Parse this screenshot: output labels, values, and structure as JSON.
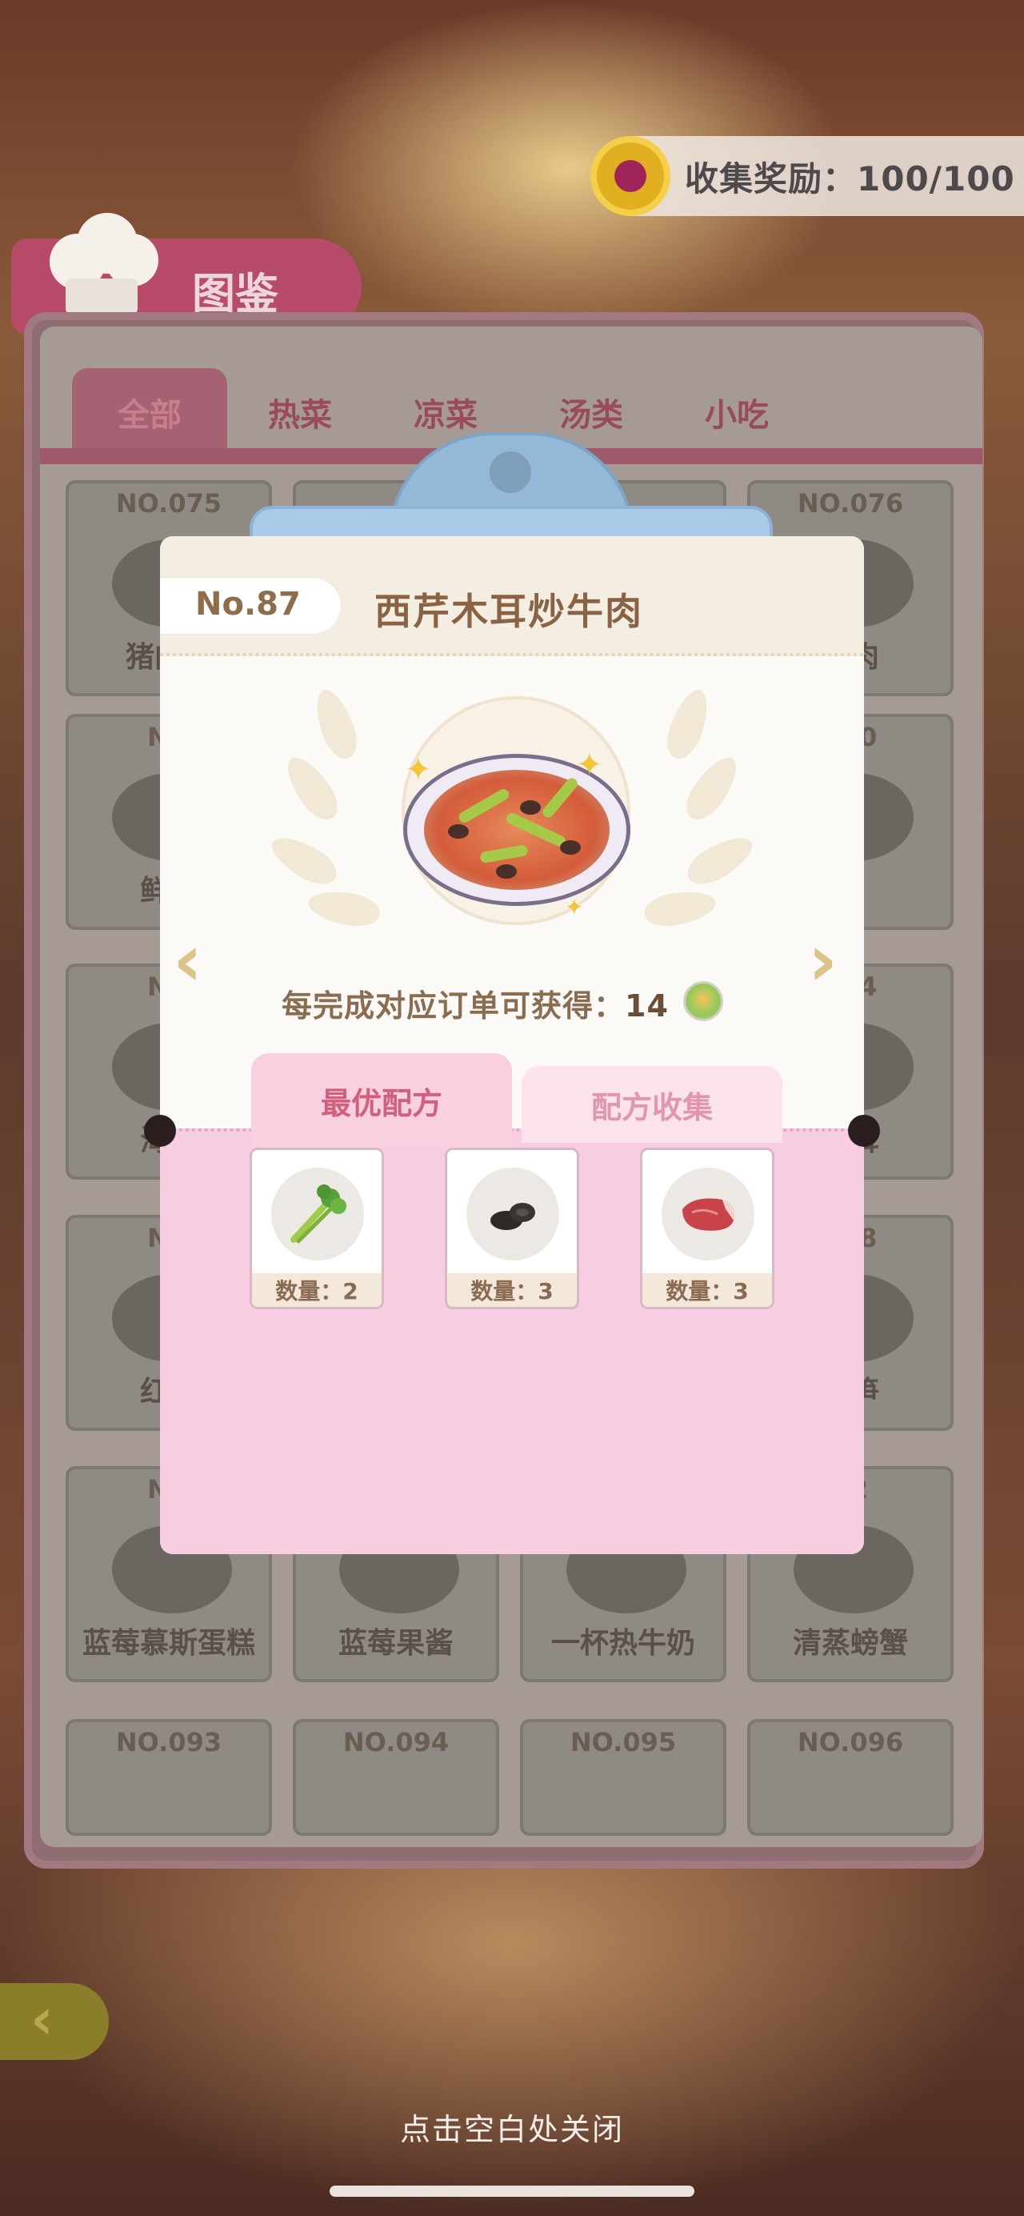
{
  "collection_reward": {
    "label": "收集奖励：100/100"
  },
  "page_title": "图鉴",
  "category_tabs": [
    {
      "label": "全部",
      "active": true
    },
    {
      "label": "热菜",
      "active": false
    },
    {
      "label": "凉菜",
      "active": false
    },
    {
      "label": "汤类",
      "active": false
    },
    {
      "label": "小吃",
      "active": false
    }
  ],
  "grid_cells": [
    {
      "no": "NO.075",
      "name": "猪肉酿"
    },
    {
      "no": "",
      "name": ""
    },
    {
      "no": "",
      "name": ""
    },
    {
      "no": "NO.076",
      "name": "塞肉"
    },
    {
      "no": "NO",
      "name": "鲜虾"
    },
    {
      "no": "",
      "name": ""
    },
    {
      "no": "",
      "name": ""
    },
    {
      "no": "080",
      "name": "子"
    },
    {
      "no": "NO",
      "name": "海鲜"
    },
    {
      "no": "",
      "name": ""
    },
    {
      "no": "",
      "name": ""
    },
    {
      "no": "084",
      "name": "木耳"
    },
    {
      "no": "NO",
      "name": "红烧"
    },
    {
      "no": "",
      "name": ""
    },
    {
      "no": "",
      "name": ""
    },
    {
      "no": "088",
      "name": "莴笋"
    },
    {
      "no": "NO",
      "name": "蓝莓慕斯蛋糕"
    },
    {
      "no": "",
      "name": "蓝莓果酱"
    },
    {
      "no": "",
      "name": "一杯热牛奶"
    },
    {
      "no": "92",
      "name": "清蒸螃蟹"
    },
    {
      "no": "NO.093",
      "name": ""
    },
    {
      "no": "NO.094",
      "name": ""
    },
    {
      "no": "NO.095",
      "name": ""
    },
    {
      "no": "NO.096",
      "name": ""
    }
  ],
  "dialog": {
    "number": "No.87",
    "dish_name": "西芹木耳炒牛肉",
    "reward_prefix": "每完成对应订单可获得：",
    "reward_amount": "14",
    "recipe_tabs": {
      "best": "最优配方",
      "collect": "配方收集"
    },
    "ingredients": [
      {
        "icon": "celery-icon",
        "qty": "数量：2"
      },
      {
        "icon": "wood-ear-mushroom-icon",
        "qty": "数量：3"
      },
      {
        "icon": "beef-icon",
        "qty": "数量：3"
      }
    ]
  },
  "close_hint": "点击空白处关闭"
}
